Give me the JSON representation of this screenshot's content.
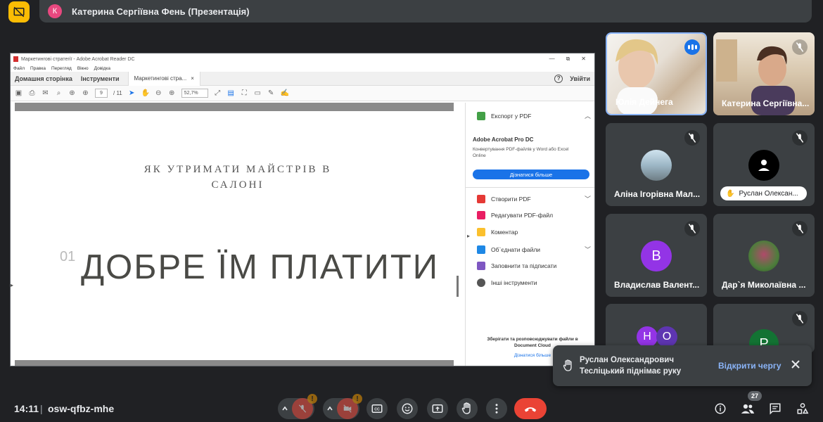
{
  "top": {
    "presenter_initial": "К",
    "presenter_label": "Катерина Сергіївна Фень (Презентація)"
  },
  "acrobat": {
    "window_title": "Маркетингові стратегії - Adobe Acrobat Reader DC",
    "window_controls": [
      "—",
      "⧉",
      "✕"
    ],
    "menu": [
      "Файл",
      "Правка",
      "Перегляд",
      "Вікно",
      "Довідка"
    ],
    "nav_home": "Домашня сторінка",
    "nav_tools": "Інструменти",
    "doc_tab": "Маркетингові стра...",
    "sign_in": "Увійти",
    "page_current": "9",
    "page_total": "/ 11",
    "zoom": "52,7%",
    "slide": {
      "subtitle_line1": "ЯК УТРИМАТИ МАЙСТРІВ В",
      "subtitle_line2": "САЛОНІ",
      "number": "01",
      "title": "ДОБРЕ ЇМ ПЛАТИТИ"
    },
    "side_panel": {
      "export_label": "Експорт у PDF",
      "pro_title": "Adobe Acrobat Pro DC",
      "pro_desc": "Конвертування PDF-файлів у Word або Excel Online",
      "learn_more": "Дізнатися більше",
      "tools": [
        {
          "label": "Створити PDF",
          "color": "#e53935"
        },
        {
          "label": "Редагувати PDF-файл",
          "color": "#e91e63"
        },
        {
          "label": "Коментар",
          "color": "#fbc02d"
        },
        {
          "label": "Об`єднати файли",
          "color": "#1e88e5"
        },
        {
          "label": "Заповнити та підписати",
          "color": "#7e57c2"
        },
        {
          "label": "Інші інструменти",
          "color": "#555555"
        }
      ],
      "footer": "Зберігати та розповсюджувати файли в Document Cloud",
      "footer_link": "Дізнатися більше"
    }
  },
  "tiles": [
    {
      "name": "Юлія Дейнега",
      "type": "video",
      "speaking": true
    },
    {
      "name": "Катерина Сергіївна...",
      "type": "video"
    },
    {
      "name": "Аліна Ігорівна Мал...",
      "type": "photo"
    },
    {
      "name": "Руслан Олексан...",
      "type": "anon"
    },
    {
      "name": "Владислав Валент...",
      "type": "letter",
      "letter": "В",
      "color": "#9334e6"
    },
    {
      "name": "Дар`я Миколаївна ...",
      "type": "photo2"
    },
    {
      "letters": [
        "Н",
        "О"
      ],
      "type": "group"
    },
    {
      "letter": "Р",
      "type": "letter-partial",
      "color": "#137333"
    }
  ],
  "toast": {
    "message": "Руслан Олександрович Теслiцький піднімає руку",
    "action": "Відкрити чергу"
  },
  "bottom": {
    "time": "14:11",
    "separator": "|",
    "meeting_code": "osw-qfbz-mhe",
    "people_count": "27",
    "warn": "!"
  }
}
